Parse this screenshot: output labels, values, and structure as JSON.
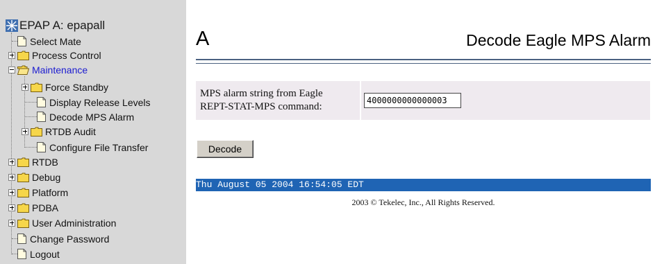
{
  "tree": {
    "root_label": "EPAP A: epapall",
    "items": [
      {
        "label": "Select Mate",
        "kind": "page",
        "level": 1
      },
      {
        "label": "Process Control",
        "kind": "folder",
        "level": 1,
        "expander": "plus"
      },
      {
        "label": "Maintenance",
        "kind": "folder-open",
        "level": 1,
        "expander": "minus",
        "active": true
      },
      {
        "label": "Force Standby",
        "kind": "folder",
        "level": 2,
        "expander": "plus"
      },
      {
        "label": "Display Release Levels",
        "kind": "page",
        "level": 2
      },
      {
        "label": "Decode MPS Alarm",
        "kind": "page",
        "level": 2
      },
      {
        "label": "RTDB Audit",
        "kind": "folder",
        "level": 2,
        "expander": "plus"
      },
      {
        "label": "Configure File Transfer",
        "kind": "page",
        "level": 2
      },
      {
        "label": "RTDB",
        "kind": "folder",
        "level": 1,
        "expander": "plus"
      },
      {
        "label": "Debug",
        "kind": "folder",
        "level": 1,
        "expander": "plus"
      },
      {
        "label": "Platform",
        "kind": "folder",
        "level": 1,
        "expander": "plus"
      },
      {
        "label": "PDBA",
        "kind": "folder",
        "level": 1,
        "expander": "plus"
      },
      {
        "label": "User Administration",
        "kind": "folder",
        "level": 1,
        "expander": "plus"
      },
      {
        "label": "Change Password",
        "kind": "page",
        "level": 1
      },
      {
        "label": "Logout",
        "kind": "page",
        "level": 1
      }
    ]
  },
  "main": {
    "server_letter": "A",
    "title": "Decode Eagle MPS Alarm",
    "form": {
      "label_line1": "MPS alarm string from Eagle",
      "label_line2": "REPT-STAT-MPS command:",
      "alarm_value": "4000000000000003"
    },
    "decode_button": "Decode",
    "timestamp": "Thu August 05 2004 16:54:05 EDT",
    "copyright": "2003 © Tekelec, Inc., All Rights Reserved."
  },
  "colors": {
    "tree_bg": "#d8d8d8",
    "active_link": "#1b1bd0",
    "date_bar": "#1f64b4",
    "title_rule": "#4a6080",
    "form_bg": "#efeaef",
    "folder": "#f6d64a"
  }
}
